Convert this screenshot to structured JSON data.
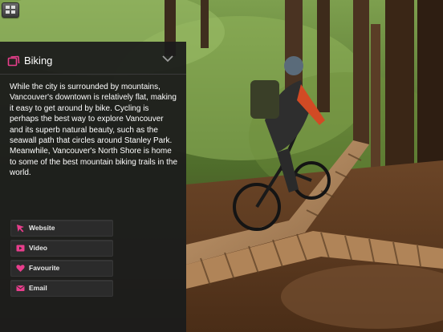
{
  "colors": {
    "accent": "#e83e8c",
    "panel": "#1c1c1c"
  },
  "panel": {
    "title": "Biking",
    "icon": "photo-stack-icon",
    "description": "While the city is surrounded by mountains, Vancouver's downtown is relatively flat, making it easy to get around by bike. Cycling is perhaps the best way to explore Vancouver and its superb natural beauty, such as the seawall path that circles around Stanley Park. Meanwhile, Vancouver's North Shore is home to some of the best mountain biking trails in the world."
  },
  "actions": [
    {
      "label": "Website",
      "icon": "cursor-arrow-icon"
    },
    {
      "label": "Video",
      "icon": "play-icon"
    },
    {
      "label": "Favourite",
      "icon": "heart-icon"
    },
    {
      "label": "Email",
      "icon": "envelope-icon"
    }
  ]
}
